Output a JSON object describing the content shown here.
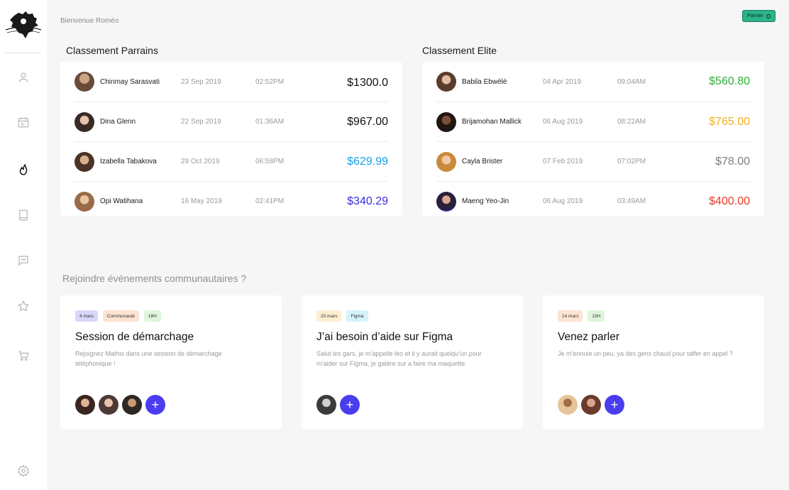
{
  "header": {
    "greeting": "Bienvenue Roméo",
    "badge_label": "Parrain"
  },
  "sidebar": {
    "items": [
      {
        "icon": "user-icon"
      },
      {
        "icon": "calendar-icon"
      },
      {
        "icon": "fire-icon",
        "active": true
      },
      {
        "icon": "book-icon"
      },
      {
        "icon": "chat-icon"
      },
      {
        "icon": "star-icon"
      },
      {
        "icon": "cart-icon"
      },
      {
        "icon": "gear-icon"
      }
    ]
  },
  "parrains": {
    "title": "Classement Parrains",
    "rows": [
      {
        "name": "Chinmay Sarasvati",
        "date": "23 Sep 2019",
        "time": "02:52PM",
        "amount": "$1300.0",
        "color": "#111111"
      },
      {
        "name": "Dina Glenn",
        "date": "22 Sep 2019",
        "time": "01:36AM",
        "amount": "$967.00",
        "color": "#111111"
      },
      {
        "name": "Izabella Tabakova",
        "date": "29 Oct 2019",
        "time": "06:58PM",
        "amount": "$629.99",
        "color": "#1aa3e8"
      },
      {
        "name": "Opi Watihana",
        "date": "16 May 2019",
        "time": "02:41PM",
        "amount": "$340.29",
        "color": "#3b2fd6"
      }
    ]
  },
  "elite": {
    "title": "Classement Elite",
    "rows": [
      {
        "name": "Babila Ebwélé",
        "date": "04 Apr 2019",
        "time": "09:04AM",
        "amount": "$560.80",
        "color": "#2fae3b"
      },
      {
        "name": "Brijamohan Mallick",
        "date": "06 Aug 2019",
        "time": "08:22AM",
        "amount": "$765.00",
        "color": "#f2b01e"
      },
      {
        "name": "Cayla Brister",
        "date": "07 Feb 2019",
        "time": "07:02PM",
        "amount": "$78.00",
        "color": "#7f7f7f"
      },
      {
        "name": "Maeng Yeo-Jin",
        "date": "06 Aug 2019",
        "time": "03:49AM",
        "amount": "$400.00",
        "color": "#e83a2a"
      }
    ]
  },
  "events": {
    "title": "Rejoindre événements communautaires ?",
    "cards": [
      {
        "tags": [
          {
            "label": "4 mars",
            "bg": "#d9d6fb"
          },
          {
            "label": "Communauté",
            "bg": "#fde3d2"
          },
          {
            "label": "18H",
            "bg": "#dff5dc"
          }
        ],
        "title": "Session de démarchage",
        "description": "Rejoignez Mathis dans une session de démarchage téléphonique !",
        "plus": "+"
      },
      {
        "tags": [
          {
            "label": "20 mars",
            "bg": "#fdeed0"
          },
          {
            "label": "Figma",
            "bg": "#d6f3fb"
          }
        ],
        "title": "J’ai besoin d’aide sur Figma",
        "description": "Salut les gars, je m’appelle léo et  il y aurait quelqu’un pour m’aider sur Figma, je galère sur a faire ma maquette.",
        "plus": "+"
      },
      {
        "tags": [
          {
            "label": "14 mars",
            "bg": "#fde3d2"
          },
          {
            "label": "15H",
            "bg": "#dff5dc"
          }
        ],
        "title": "Venez parler",
        "description": "Je m’ennuie un peu,  ya des gens chaud pour taffer en appel ?",
        "plus": "+"
      }
    ]
  },
  "colors": {
    "accent": "#4a3df0",
    "badge": "#2bb38a"
  }
}
